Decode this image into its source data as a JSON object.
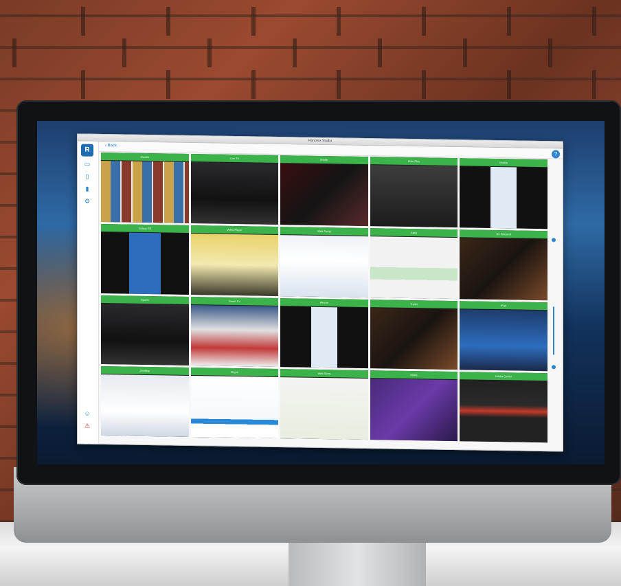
{
  "window": {
    "title": "Ranorex Studio",
    "subtitle": "",
    "back_label": "Back",
    "help_icon": "?",
    "footer_text": ""
  },
  "sidebar": {
    "logo": "R",
    "icons": [
      "monitor-icon",
      "tablet-icon",
      "phone-icon",
      "gear-icon"
    ],
    "bottom_icons": [
      "person-icon",
      "warning-icon"
    ]
  },
  "tiles": [
    {
      "label": "Movies",
      "theme": "posters"
    },
    {
      "label": "Live TV",
      "theme": "dark-ui"
    },
    {
      "label": "Netflix",
      "theme": "netflix"
    },
    {
      "label": "Hulu Plus",
      "theme": "site"
    },
    {
      "label": "Mobile",
      "theme": "phone"
    },
    {
      "label": "Galaxy S5",
      "theme": "phone-blue"
    },
    {
      "label": "Video Player",
      "theme": "cartoon"
    },
    {
      "label": "Web Portal",
      "theme": "webpage"
    },
    {
      "label": "Apps",
      "theme": "apps"
    },
    {
      "label": "On Demand",
      "theme": "dark-poster"
    },
    {
      "label": "Sports",
      "theme": "dark-ui"
    },
    {
      "label": "Smart TV",
      "theme": "tv-ui"
    },
    {
      "label": "iPhone",
      "theme": "phone"
    },
    {
      "label": "Trailer",
      "theme": "dark-poster"
    },
    {
      "label": "iPad",
      "theme": "ipad"
    },
    {
      "label": "Desktop",
      "theme": "desktop"
    },
    {
      "label": "Skype",
      "theme": "skype"
    },
    {
      "label": "Web Store",
      "theme": "store"
    },
    {
      "label": "Music",
      "theme": "purple"
    },
    {
      "label": "Media Center",
      "theme": "media"
    }
  ],
  "colors": {
    "accent": "#3bb24a",
    "brand": "#1f6db0",
    "link": "#2f86cf"
  }
}
